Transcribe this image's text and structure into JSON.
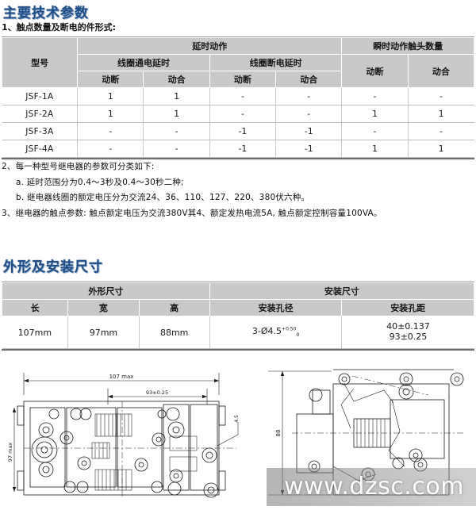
{
  "sections": {
    "params": {
      "title": "主要技术参数",
      "subtitle": "1、触点数量及断电的件形式:",
      "table": {
        "header_row1": [
          "型号",
          "延时动作",
          "瞬时动作触头数量"
        ],
        "header_row2": [
          "线圈通电延时",
          "线圈断电延时"
        ],
        "header_row3": [
          "动断",
          "动合",
          "动断",
          "动合",
          "动断",
          "动合"
        ],
        "rows": [
          {
            "model": "JSF-1A",
            "c1": "1",
            "c2": "1",
            "c3": "-",
            "c4": "-",
            "c5": "-",
            "c6": "-"
          },
          {
            "model": "JSF-2A",
            "c1": "1",
            "c2": "1",
            "c3": "-",
            "c4": "-",
            "c5": "1",
            "c6": "1"
          },
          {
            "model": "JSF-3A",
            "c1": "-",
            "c2": "-",
            "c3": "-1",
            "c4": "-1",
            "c5": "-",
            "c6": "-"
          },
          {
            "model": "JSF-4A",
            "c1": "-",
            "c2": "-",
            "c3": "-1",
            "c4": "-1",
            "c5": "1",
            "c6": "1"
          }
        ]
      },
      "notes": [
        "2、每一种型号继电器的参数可分类如下:",
        "a. 延时范围分为0.4～3秒及0.4～30秒二种;",
        "b. 继电器线圈的额定电压分为交流24、36、110、127、220、380伏六种。",
        "3、继电器的触点参数: 触点额定电压为交流380V其4、额定发热电流5A, 触点额定控制容量100VA。"
      ]
    },
    "dims": {
      "title": "外形及安装尺寸",
      "table": {
        "header_row1": [
          "外形尺寸",
          "安装尺寸"
        ],
        "header_row2": [
          "长",
          "宽",
          "高",
          "安装孔径",
          "安装孔距"
        ],
        "row": {
          "length": "107mm",
          "width": "97mm",
          "height": "88mm",
          "hole_diameter_prefix": "3-Ø4.5",
          "hole_diameter_sup": "+0.50",
          "hole_diameter_sub": "0",
          "hole_pitch_line1": "40±0.137",
          "hole_pitch_line2": "93±0.25"
        }
      }
    }
  },
  "drawings": {
    "left": {
      "dim_top": "107 max",
      "dim_inner": "93±0.25",
      "dim_side": "97 max"
    },
    "right": {
      "dim_side": "88"
    }
  },
  "watermark": {
    "text": "www.dzsc.com"
  }
}
